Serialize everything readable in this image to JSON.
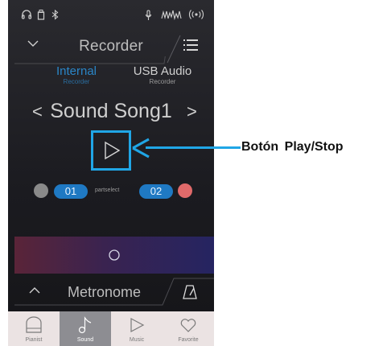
{
  "status_bar": {
    "icons": [
      "headphones-icon",
      "usb-memory-icon",
      "bluetooth-icon",
      "microphone-icon",
      "sound-level-icon",
      "wireless-icon"
    ]
  },
  "header": {
    "title": "Recorder"
  },
  "tabs": [
    {
      "label": "Internal",
      "sublabel": "Recorder",
      "active": true
    },
    {
      "label": "USB Audio",
      "sublabel": "Recorder",
      "active": false
    }
  ],
  "song": {
    "title": "Sound Song1",
    "prev_symbol": "<",
    "next_symbol": ">"
  },
  "parts": {
    "part1": "01",
    "part2": "02",
    "separator_label": "partselect"
  },
  "metronome": {
    "title": "Metronome"
  },
  "bottom_nav": [
    {
      "label": "Pianist",
      "icon": "piano-icon",
      "active": false
    },
    {
      "label": "Sound",
      "icon": "music-note-icon",
      "active": true
    },
    {
      "label": "Music",
      "icon": "play-outline-icon",
      "active": false
    },
    {
      "label": "Favorite",
      "icon": "heart-icon",
      "active": false
    }
  ],
  "annotation": {
    "label": "Botón  Play/Stop"
  },
  "colors": {
    "accent": "#20a6e6",
    "part_blue": "#1f79c3",
    "record_red": "#e06a6a",
    "inactive_gray": "#8a8a8a"
  }
}
